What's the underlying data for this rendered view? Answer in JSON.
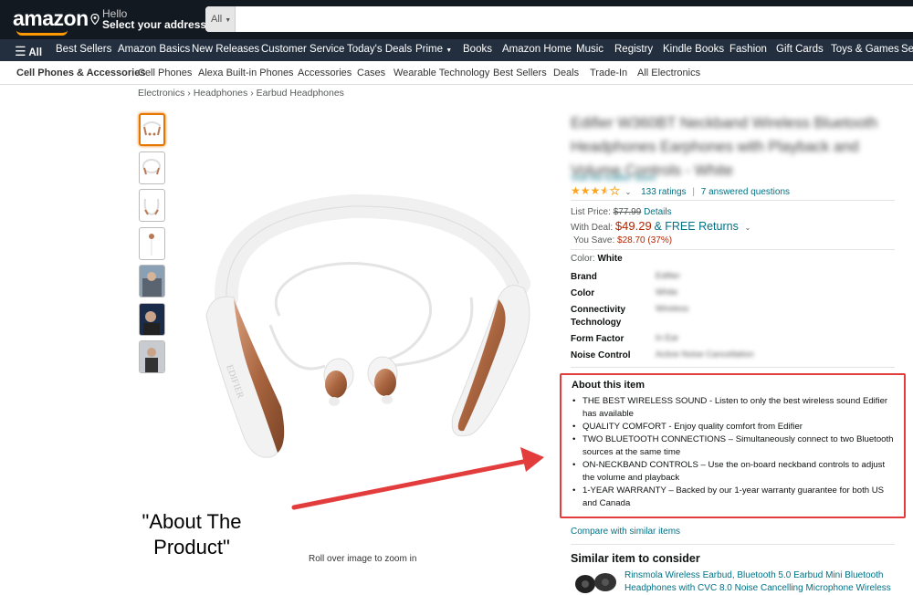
{
  "header": {
    "logo": "amazon",
    "deliver_line1": "Hello",
    "deliver_line2": "Select your address",
    "search_category": "All"
  },
  "nav": {
    "all_label": "All",
    "items": [
      "Best Sellers",
      "Amazon Basics",
      "New Releases",
      "Customer Service",
      "Today's Deals",
      "Prime",
      "Books",
      "Amazon Home",
      "Music",
      "Registry",
      "Kindle Books",
      "Fashion",
      "Gift Cards",
      "Toys & Games",
      "Se"
    ]
  },
  "subnav": {
    "items": [
      "Cell Phones & Accessories",
      "Cell Phones",
      "Alexa Built-in Phones",
      "Accessories",
      "Cases",
      "Wearable Technology",
      "Best Sellers",
      "Deals",
      "Trade-In",
      "All Electronics"
    ]
  },
  "breadcrumb": [
    "Electronics",
    "Headphones",
    "Earbud Headphones"
  ],
  "gallery": {
    "zoom_hint": "Roll over image to zoom in",
    "brand_mark": "EDIFIER"
  },
  "callout": {
    "line1": "\"About The",
    "line2": "Product\""
  },
  "product": {
    "title": "Edifier W360BT Neckband Wireless Bluetooth Headphones Earphones with Playback and Volume Controls - White",
    "store": "Visit the Edifier Store",
    "rating_value": 3.5,
    "ratings_count": "133 ratings",
    "answered": "7 answered questions",
    "list_price_label": "List Price:",
    "list_price": "$77.99",
    "details_link": "Details",
    "deal_label": "With Deal:",
    "deal_price": "$49.29",
    "free_returns": "& FREE Returns",
    "save_label": "You Save:",
    "save_value": "$28.70 (37%)",
    "color_label": "Color:",
    "color_value": "White",
    "specs": [
      {
        "label": "Brand",
        "value": "Edifier"
      },
      {
        "label": "Color",
        "value": "White"
      },
      {
        "label": "Connectivity Technology",
        "value": "Wireless"
      },
      {
        "label": "Form Factor",
        "value": "In Ear"
      },
      {
        "label": "Noise Control",
        "value": "Active Noise Cancellation"
      }
    ]
  },
  "about": {
    "heading": "About this item",
    "bullets": [
      "THE BEST WIRELESS SOUND - Listen to only the best wireless sound Edifier has available",
      "QUALITY COMFORT - Enjoy quality comfort from Edifier",
      "TWO BLUETOOTH CONNECTIONS – Simultaneously connect to two Bluetooth sources at the same time",
      "ON-NECKBAND CONTROLS – Use the on-board neckband controls to adjust the volume and playback",
      "1-YEAR WARRANTY – Backed by our 1-year warranty guarantee for both US and Canada"
    ]
  },
  "compare_link": "Compare with similar items",
  "similar": {
    "heading": "Similar item to consider",
    "text": "Rinsmola Wireless Earbud, Bluetooth 5.0 Earbud Mini Bluetooth Headphones with CVC 8.0 Noise Cancelling Microphone Wireless"
  },
  "colors": {
    "topbar": "#131921",
    "nav": "#232f3e",
    "accent": "#ff9900",
    "link": "#007185",
    "price": "#b12704",
    "callout_box": "#e23c3c"
  }
}
